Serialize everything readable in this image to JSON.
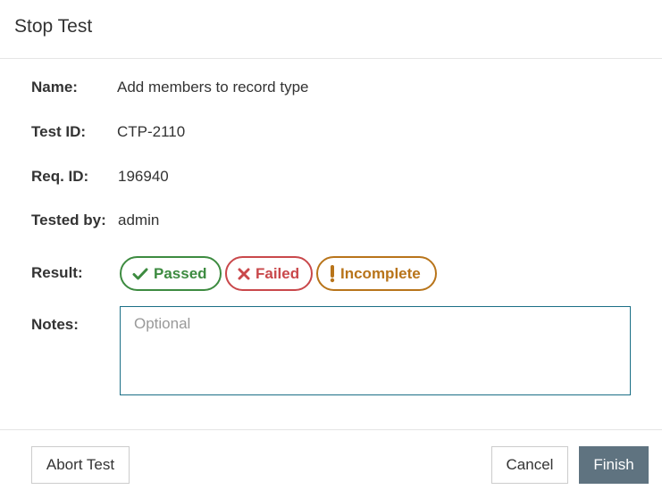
{
  "dialog": {
    "title": "Stop Test"
  },
  "fields": {
    "name": {
      "label": "Name:",
      "value": "Add members to record type"
    },
    "test_id": {
      "label": "Test ID:",
      "value": "CTP-2110"
    },
    "req_id": {
      "label": "Req. ID:",
      "value": "196940"
    },
    "tested_by": {
      "label": "Tested by:",
      "value": "admin"
    },
    "result": {
      "label": "Result:"
    },
    "notes": {
      "label": "Notes:",
      "placeholder": "Optional",
      "value": ""
    }
  },
  "result_options": {
    "passed": {
      "label": "Passed",
      "icon": "check-icon",
      "color": "#3d8b40"
    },
    "failed": {
      "label": "Failed",
      "icon": "x-icon",
      "color": "#c9484b"
    },
    "incomplete": {
      "label": "Incomplete",
      "icon": "exclamation-icon",
      "color": "#b8741a"
    }
  },
  "footer": {
    "abort_label": "Abort Test",
    "cancel_label": "Cancel",
    "finish_label": "Finish",
    "finish_color": "#5f7380"
  }
}
